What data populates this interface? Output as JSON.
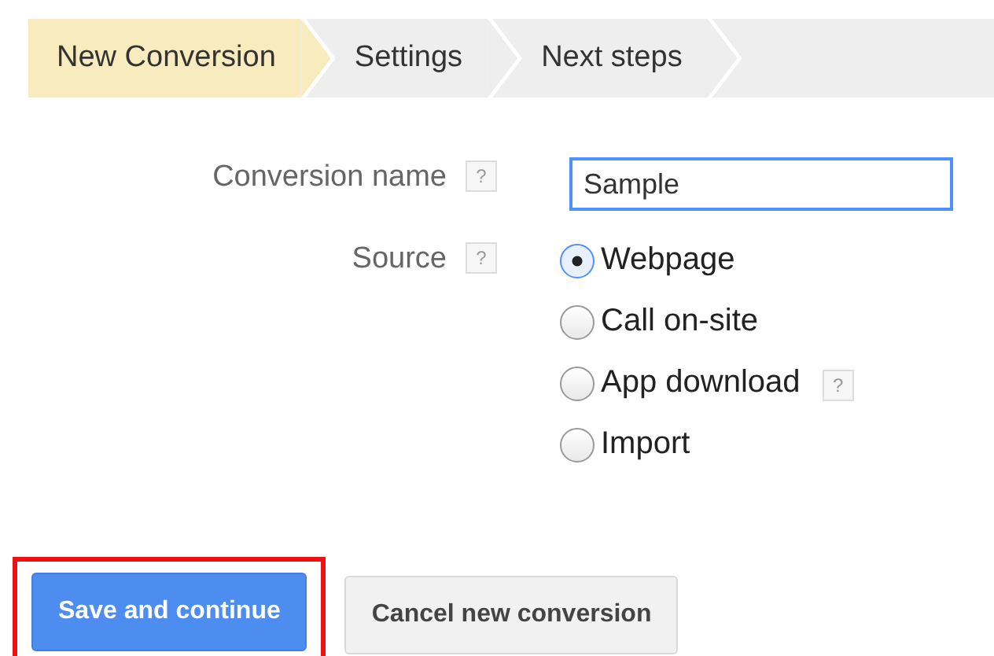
{
  "steps": [
    {
      "label": "New Conversion",
      "selected": true
    },
    {
      "label": "Settings",
      "selected": false
    },
    {
      "label": "Next steps",
      "selected": false
    }
  ],
  "conversion_name": {
    "label": "Conversion name",
    "help": "?",
    "value": "Sample"
  },
  "source": {
    "label": "Source",
    "help": "?",
    "options": [
      {
        "label": "Webpage",
        "selected": true
      },
      {
        "label": "Call on-site",
        "selected": false
      },
      {
        "label": "App download",
        "selected": false,
        "help": "?"
      },
      {
        "label": "Import",
        "selected": false
      }
    ]
  },
  "buttons": [
    {
      "label": "Save and continue",
      "kind": "primary",
      "highlighted": true
    },
    {
      "label": "Cancel new conversion",
      "kind": "secondary",
      "highlighted": false
    }
  ]
}
